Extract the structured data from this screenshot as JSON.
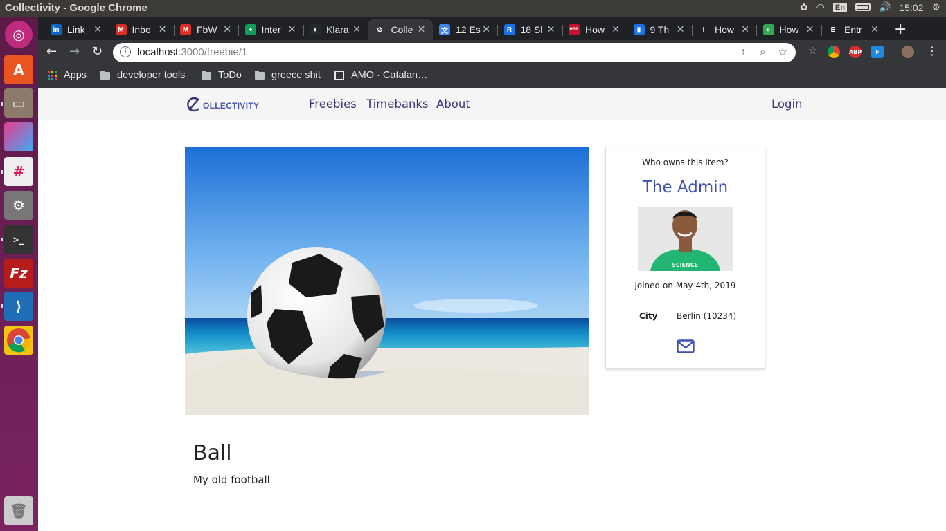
{
  "os": {
    "window_title": "Collectivity - Google Chrome",
    "language": "En",
    "clock": "15:02"
  },
  "browser": {
    "tabs": [
      {
        "label": "Link",
        "icon": "linkedin-icon",
        "color": "#0a66c2",
        "glyph": "in"
      },
      {
        "label": "Inbo",
        "icon": "gmail-icon",
        "color": "#d93025",
        "glyph": "M"
      },
      {
        "label": "FbW",
        "icon": "gmail-icon",
        "color": "#d93025",
        "glyph": "M"
      },
      {
        "label": "Inter",
        "icon": "sheets-icon",
        "color": "#0f9d58",
        "glyph": "+"
      },
      {
        "label": "Klara",
        "icon": "github-icon",
        "color": "#24292e",
        "glyph": "●"
      },
      {
        "label": "Colle",
        "icon": "collectivity-icon",
        "color": "#35363a",
        "glyph": "⊘"
      },
      {
        "label": "12 Es",
        "icon": "translate-icon",
        "color": "#4285f4",
        "glyph": "文"
      },
      {
        "label": "18 Sl",
        "icon": "r-icon",
        "color": "#1a73e8",
        "glyph": "R"
      },
      {
        "label": "How",
        "icon": "hbr-icon",
        "color": "#c8102e",
        "glyph": "HBR"
      },
      {
        "label": "9 Th",
        "icon": "chart-icon",
        "color": "#1a73e8",
        "glyph": "▮"
      },
      {
        "label": "How",
        "icon": "medium-icon",
        "color": "#202124",
        "glyph": "I"
      },
      {
        "label": "How",
        "icon": "green-circle-icon",
        "color": "#34a853",
        "glyph": "◐"
      },
      {
        "label": "Entr",
        "icon": "e-icon",
        "color": "#202124",
        "glyph": "E"
      }
    ],
    "active_tab": 5,
    "url_host": "localhost",
    "url_path": ":3000/freebie/1",
    "bookmarks": [
      {
        "label": "Apps",
        "icon": "apps-grid-icon"
      },
      {
        "label": "developer tools",
        "icon": "folder-icon"
      },
      {
        "label": "ToDo",
        "icon": "folder-icon"
      },
      {
        "label": "greece shit",
        "icon": "folder-icon"
      },
      {
        "label": "AMO · Catalan…",
        "icon": "amo-icon"
      }
    ]
  },
  "site": {
    "logo_text": "OLLECTIVITY",
    "nav": [
      "Freebies",
      "Timebanks",
      "About"
    ],
    "login": "Login",
    "accent": "#3f51b5"
  },
  "item": {
    "title": "Ball",
    "description": "My old football"
  },
  "owner": {
    "question": "Who owns this item?",
    "name": "The Admin",
    "joined": "joined on May 4th, 2019",
    "city_label": "City",
    "city_value": "Berlin (10234)",
    "shirt_text": "SCIENCE"
  }
}
